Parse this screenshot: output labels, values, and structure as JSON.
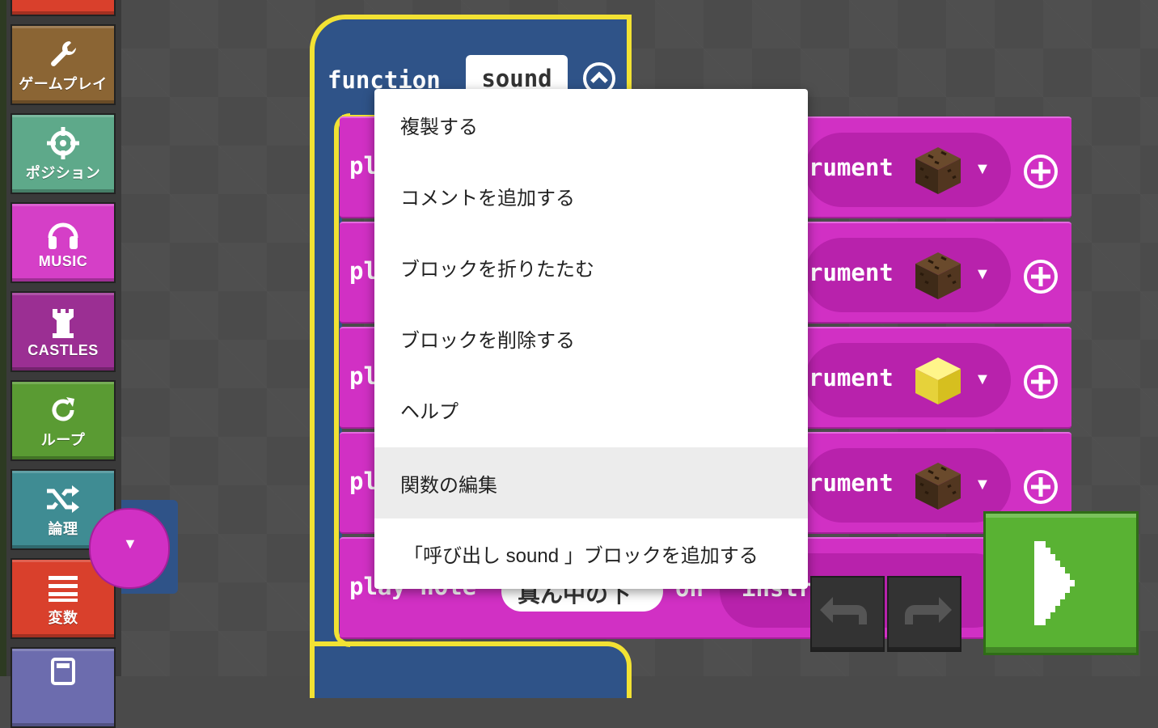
{
  "toolbox": {
    "categories": [
      {
        "label": "ゲームプレイ",
        "color": "#8b6534",
        "icon": "wrench-icon"
      },
      {
        "label": "ポジション",
        "color": "#5ea98a",
        "icon": "crosshair-icon"
      },
      {
        "label": "MUSIC",
        "color": "#d53fc7",
        "icon": "headphones-icon"
      },
      {
        "label": "CASTLES",
        "color": "#9b2f93",
        "icon": "castle-tower-icon"
      },
      {
        "label": "ループ",
        "color": "#5a9b33",
        "icon": "loop-arrow-icon"
      },
      {
        "label": "論理",
        "color": "#3f8c93",
        "icon": "shuffle-icon"
      },
      {
        "label": "変数",
        "color": "#d9402c",
        "icon": "list-icon"
      }
    ]
  },
  "function_block": {
    "keyword": "function",
    "name": "sound"
  },
  "rows": [
    {
      "play_text": "pl",
      "instrument_text": "rument",
      "block": "dirt"
    },
    {
      "play_text": "pl",
      "instrument_text": "rument",
      "block": "dirt"
    },
    {
      "play_text": "pl",
      "instrument_text": "rument",
      "block": "gold"
    },
    {
      "play_text": "pl",
      "instrument_text": "rument",
      "block": "dirt"
    }
  ],
  "last_row": {
    "play_text": "play note",
    "note_value": "真ん中の下",
    "on_text": "on",
    "instrument_text": "instrument"
  },
  "context_menu": {
    "items": [
      {
        "label": "複製する"
      },
      {
        "label": "コメントを追加する"
      },
      {
        "label": "ブロックを折りたたむ"
      },
      {
        "label": "ブロックを削除する"
      },
      {
        "label": "ヘルプ"
      },
      {
        "label": "関数の編集"
      },
      {
        "label": "「呼び出し sound 」ブロックを追加する"
      }
    ],
    "highlighted_index": 5
  },
  "controls": {
    "undo_icon": "undo-icon",
    "redo_icon": "redo-icon",
    "run_icon": "play-icon"
  },
  "colors": {
    "function_block": "#2f5388",
    "function_outline": "#f2e233",
    "music_block": "#d130c4",
    "run_button": "#59b233"
  }
}
